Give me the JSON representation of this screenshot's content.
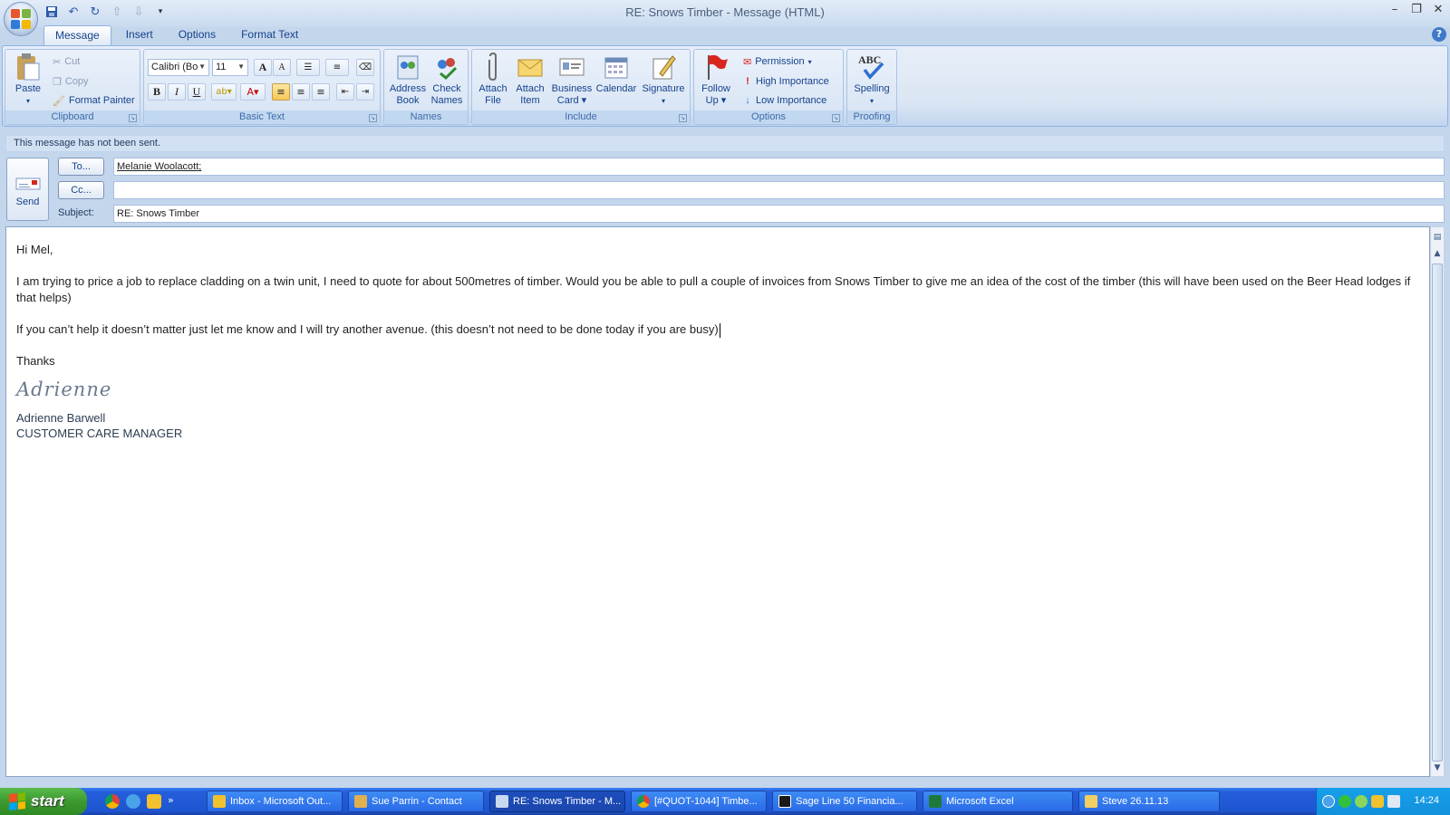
{
  "window": {
    "title": "RE: Snows Timber - Message (HTML)"
  },
  "ribbon_tabs": [
    {
      "label": "Message",
      "active": true
    },
    {
      "label": "Insert"
    },
    {
      "label": "Options"
    },
    {
      "label": "Format Text"
    }
  ],
  "clipboard": {
    "paste": "Paste",
    "cut": "Cut",
    "copy": "Copy",
    "format_painter": "Format Painter",
    "group": "Clipboard"
  },
  "basic_text": {
    "font": "Calibri (Bo",
    "size": "11",
    "bold": "B",
    "italic": "I",
    "underline": "U",
    "group": "Basic Text"
  },
  "names": {
    "address_book": [
      "Address",
      "Book"
    ],
    "check_names": [
      "Check",
      "Names"
    ],
    "group": "Names"
  },
  "include": {
    "attach_file": [
      "Attach",
      "File"
    ],
    "attach_item": [
      "Attach",
      "Item"
    ],
    "business_card": [
      "Business",
      "Card"
    ],
    "calendar": "Calendar",
    "signature": "Signature",
    "group": "Include"
  },
  "options": {
    "follow_up": [
      "Follow",
      "Up"
    ],
    "permission": "Permission",
    "high_importance": "High Importance",
    "low_importance": "Low Importance",
    "group": "Options"
  },
  "proofing": {
    "spelling": "Spelling",
    "group": "Proofing"
  },
  "info_bar": "This message has not been sent.",
  "compose": {
    "send": "Send",
    "to_button": "To...",
    "cc_button": "Cc...",
    "subject_label": "Subject:",
    "to_value": "Melanie Woolacott;",
    "cc_value": "",
    "subject_value": "RE: Snows Timber"
  },
  "message": {
    "greeting": "Hi Mel,",
    "para1": "I am trying to price a job to replace cladding on a twin unit, I need to quote for about 500metres of timber.   Would you be able to pull a couple of invoices from Snows Timber to give me an idea of the cost of the timber (this will have been used on the Beer Head lodges if that helps)",
    "para2": "If you can’t help it doesn’t matter just let me know and I will try another avenue.  (this doesn’t not need to be done today if you are busy)",
    "closing": "Thanks",
    "signature_script": "Adrienne",
    "sig_name": "Adrienne Barwell",
    "sig_title": "CUSTOMER CARE MANAGER"
  },
  "taskbar": {
    "start": "start",
    "tasks": [
      "Inbox - Microsoft Out...",
      "Sue Parrin - Contact",
      "RE: Snows Timber - M...",
      "[#QUOT-1044] Timbe...",
      "Sage Line 50 Financia...",
      "Microsoft Excel",
      "Steve 26.11.13"
    ],
    "clock": "14:24"
  },
  "colors": {
    "accent": "#15428b",
    "ribbon_bg": "#dbe6f4",
    "taskbar": "#245edb",
    "start": "#3c9a2f"
  }
}
